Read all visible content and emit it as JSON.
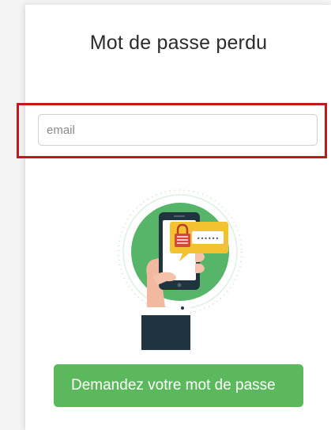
{
  "page": {
    "title": "Mot de passe perdu"
  },
  "form": {
    "email_placeholder": "email",
    "email_value": "",
    "submit_label": "Demandez votre mot de passe"
  },
  "illustration": {
    "icons": [
      "phone-icon",
      "lock-icon",
      "password-bubble-icon",
      "hand-icon"
    ],
    "password_mask": "••••••"
  },
  "colors": {
    "accent_green": "#5cb85c",
    "highlight_red": "#c2181c",
    "illustration_green": "#57b56a",
    "lock_yellow": "#f2c230",
    "dark_navy": "#1f3340"
  }
}
